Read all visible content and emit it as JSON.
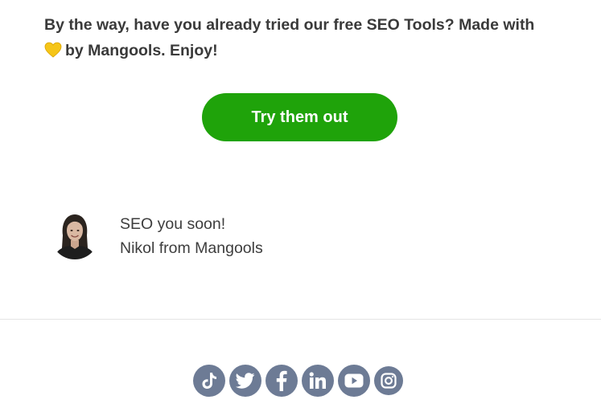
{
  "intro": {
    "line1": "By the way, have you already tried our free SEO Tools? Made with",
    "line2": "by Mangools. Enjoy!",
    "heart_icon": "yellow-heart-emoji"
  },
  "cta": {
    "label": "Try them out",
    "color": "#1fa30a"
  },
  "signoff": {
    "greeting": "SEO you soon!",
    "sender": "Nikol from Mangools",
    "avatar": "portrait-photo"
  },
  "socials": {
    "color": "#6d7b95",
    "items": [
      {
        "network": "TikTok",
        "icon": "tiktok-icon"
      },
      {
        "network": "Twitter",
        "icon": "twitter-icon"
      },
      {
        "network": "Facebook",
        "icon": "facebook-icon"
      },
      {
        "network": "LinkedIn",
        "icon": "linkedin-icon"
      },
      {
        "network": "YouTube",
        "icon": "youtube-icon"
      },
      {
        "network": "Instagram",
        "icon": "instagram-icon"
      }
    ]
  }
}
